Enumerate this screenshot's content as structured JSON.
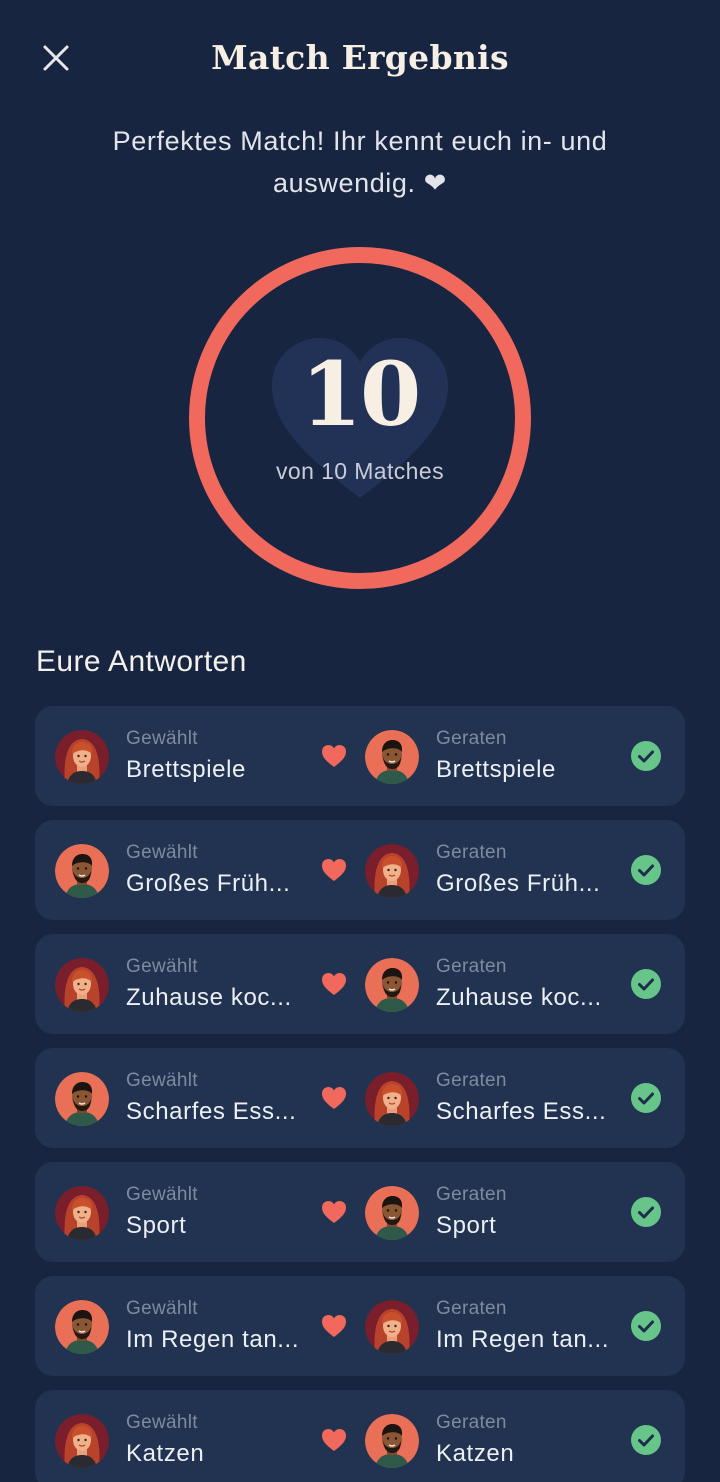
{
  "header": {
    "title": "Match Ergebnis",
    "close_icon": "close-icon"
  },
  "subtitle": "Perfektes Match! Ihr kennt euch in- und auswendig. ❤",
  "score": {
    "value": "10",
    "caption": "von 10 Matches",
    "ratio": 1.0
  },
  "colors": {
    "background": "#172541",
    "card": "#213350",
    "accent": "#f0695c",
    "check": "#67c58a"
  },
  "section_title": "Eure Antworten",
  "answers": [
    {
      "chosen_label": "Gewählt",
      "chosen": "Brettspiele",
      "guessed_label": "Geraten",
      "guessed": "Brettspiele",
      "chooser": "woman",
      "guesser": "man"
    },
    {
      "chosen_label": "Gewählt",
      "chosen": "Großes Früh...",
      "guessed_label": "Geraten",
      "guessed": "Großes Früh...",
      "chooser": "man",
      "guesser": "woman"
    },
    {
      "chosen_label": "Gewählt",
      "chosen": "Zuhause koc...",
      "guessed_label": "Geraten",
      "guessed": "Zuhause koc...",
      "chooser": "woman",
      "guesser": "man"
    },
    {
      "chosen_label": "Gewählt",
      "chosen": "Scharfes Ess...",
      "guessed_label": "Geraten",
      "guessed": "Scharfes Ess...",
      "chooser": "man",
      "guesser": "woman"
    },
    {
      "chosen_label": "Gewählt",
      "chosen": "Sport",
      "guessed_label": "Geraten",
      "guessed": "Sport",
      "chooser": "woman",
      "guesser": "man"
    },
    {
      "chosen_label": "Gewählt",
      "chosen": "Im Regen tan...",
      "guessed_label": "Geraten",
      "guessed": "Im Regen tan...",
      "chooser": "man",
      "guesser": "woman"
    },
    {
      "chosen_label": "Gewählt",
      "chosen": "Katzen",
      "guessed_label": "Geraten",
      "guessed": "Katzen",
      "chooser": "woman",
      "guesser": "man"
    }
  ]
}
